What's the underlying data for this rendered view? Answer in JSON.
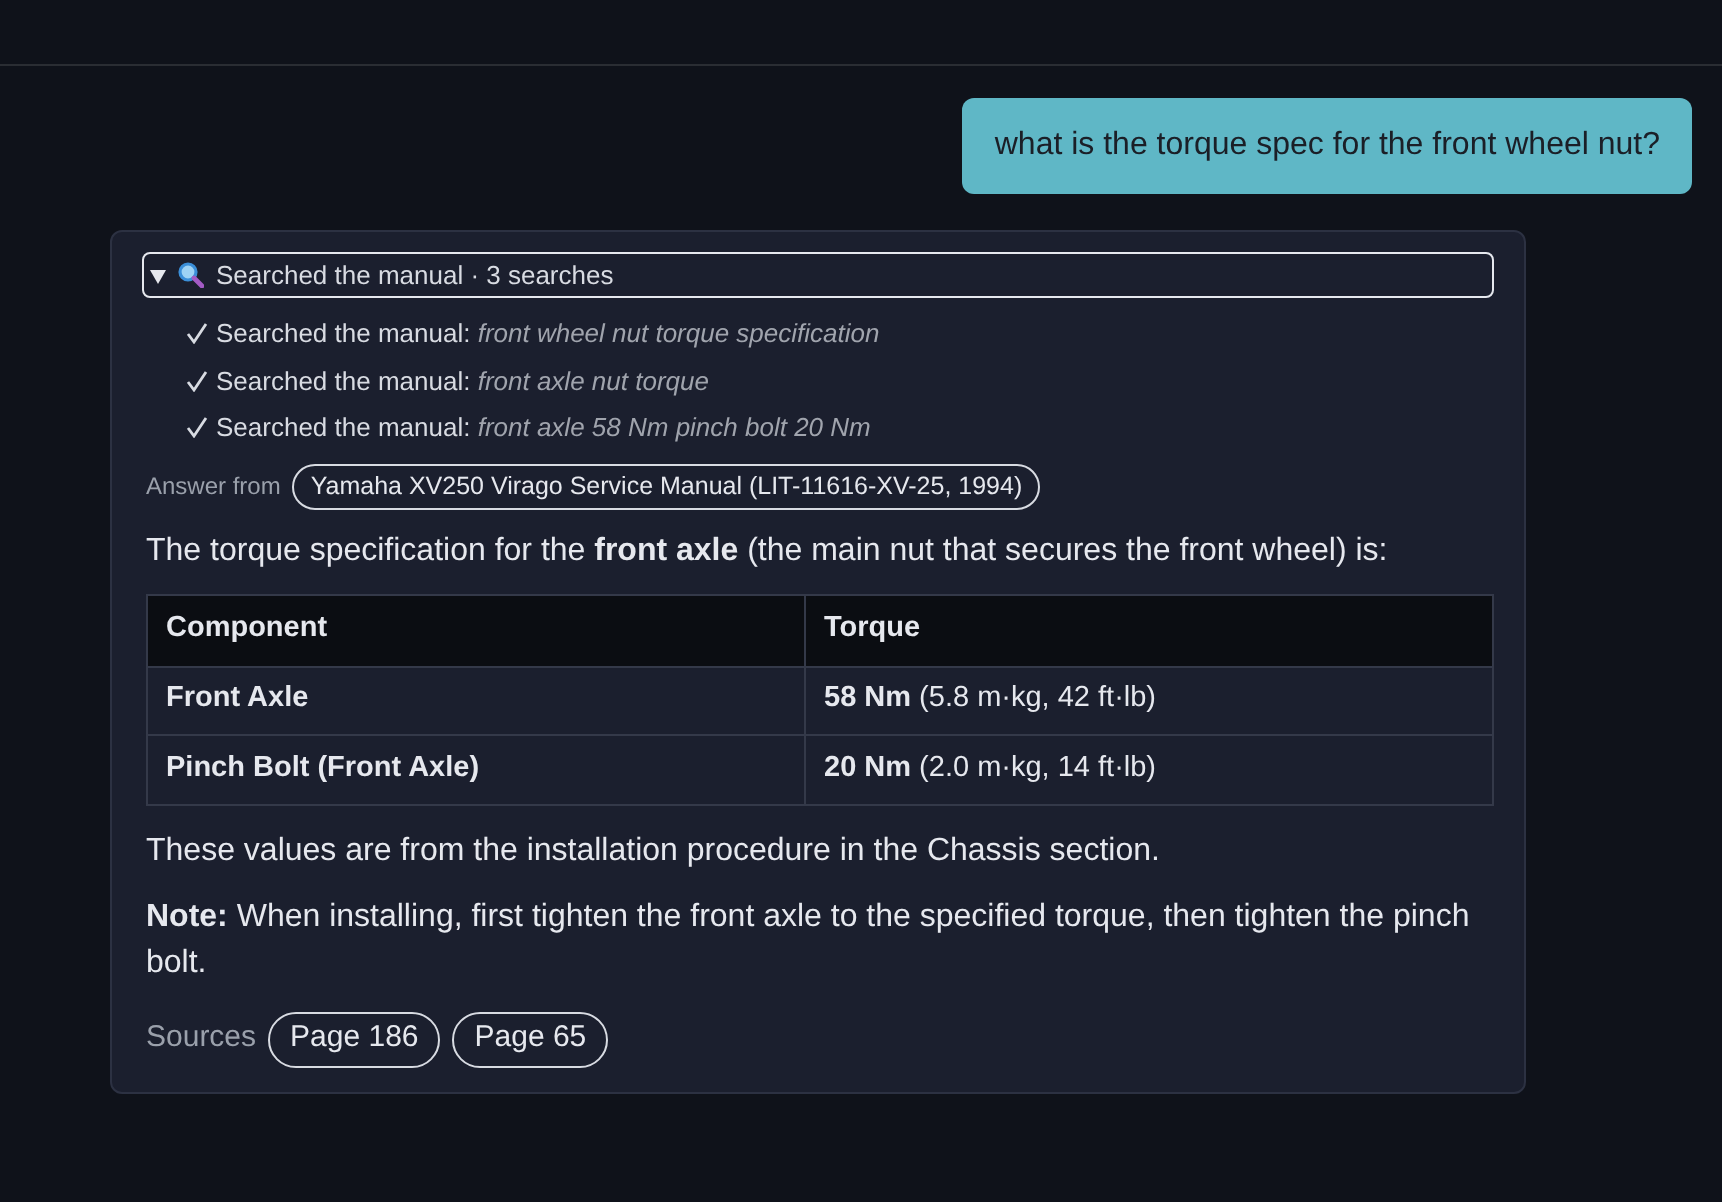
{
  "user_message": {
    "text": "what is the torque spec for the front wheel nut?"
  },
  "answer": {
    "search_log": {
      "summary": "Searched the manual · 3 searches",
      "expanded": true,
      "items": [
        {
          "label": "Searched the manual:",
          "query": "front wheel nut torque specification",
          "done": true
        },
        {
          "label": "Searched the manual:",
          "query": "front axle nut torque",
          "done": true
        },
        {
          "label": "Searched the manual:",
          "query": "front axle 58 Nm pinch bolt 20 Nm",
          "done": true
        }
      ]
    },
    "answer_from": {
      "label": "Answer from",
      "source": "Yamaha XV250 Virago Service Manual (LIT-11616-XV-25, 1994)"
    },
    "intro": "The torque specification for the **front axle** (the main nut that secures the front wheel) is:",
    "table": {
      "columns": [
        "Component",
        "Torque"
      ],
      "rows": [
        [
          "Front Axle",
          "**58 Nm** (5.8 m·kg, 42 ft·lb)"
        ],
        [
          "Pinch Bolt (Front Axle)",
          "**20 Nm** (2.0 m·kg, 14 ft·lb)"
        ]
      ]
    },
    "paragraphs": [
      "These values are from the installation procedure in the Chassis section.",
      "**Note:** When installing, first tighten the front axle to the specified torque, then tighten the pinch bolt."
    ],
    "sources": {
      "label": "Sources",
      "items": [
        "Page 186",
        "Page 65"
      ]
    }
  }
}
